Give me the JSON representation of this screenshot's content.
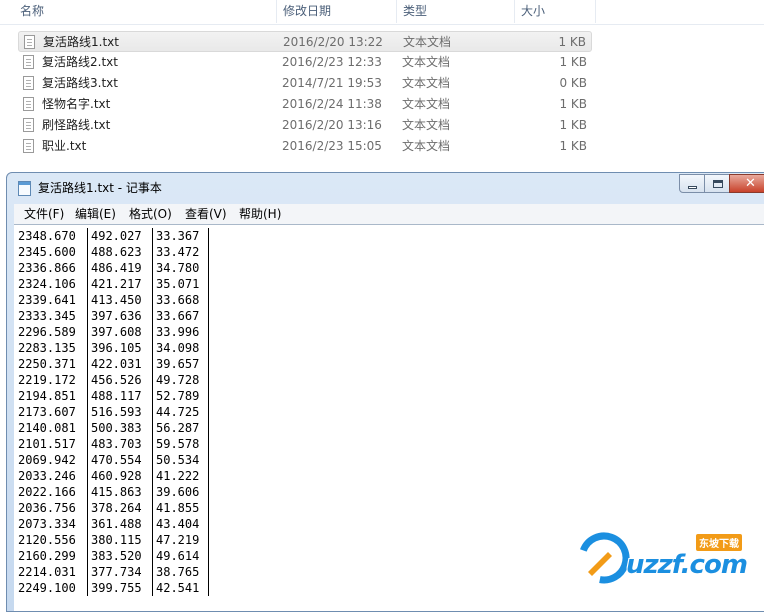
{
  "explorer": {
    "columns": {
      "name": "名称",
      "date": "修改日期",
      "type": "类型",
      "size": "大小"
    },
    "files": [
      {
        "name": "复活路线1.txt",
        "date": "2016/2/20 13:22",
        "type": "文本文档",
        "size": "1 KB"
      },
      {
        "name": "复活路线2.txt",
        "date": "2016/2/23 12:33",
        "type": "文本文档",
        "size": "1 KB"
      },
      {
        "name": "复活路线3.txt",
        "date": "2014/7/21 19:53",
        "type": "文本文档",
        "size": "0 KB"
      },
      {
        "name": "怪物名字.txt",
        "date": "2016/2/24 11:38",
        "type": "文本文档",
        "size": "1 KB"
      },
      {
        "name": "刷怪路线.txt",
        "date": "2016/2/20 13:16",
        "type": "文本文档",
        "size": "1 KB"
      },
      {
        "name": "职业.txt",
        "date": "2016/2/23 15:05",
        "type": "文本文档",
        "size": "1 KB"
      }
    ],
    "selected_index": 0
  },
  "notepad": {
    "title": "复活路线1.txt - 记事本",
    "icon": "notepad-icon",
    "menu": [
      "文件(F)",
      "编辑(E)",
      "格式(O)",
      "查看(V)",
      "帮助(H)"
    ],
    "close_glyph": "✕",
    "lines": [
      [
        "2348.670",
        "492.027",
        "33.367"
      ],
      [
        "2345.600",
        "488.623",
        "33.472"
      ],
      [
        "2336.866",
        "486.419",
        "34.780"
      ],
      [
        "2324.106",
        "421.217",
        "35.071"
      ],
      [
        "2339.641",
        "413.450",
        "33.668"
      ],
      [
        "2333.345",
        "397.636",
        "33.667"
      ],
      [
        "2296.589",
        "397.608",
        "33.996"
      ],
      [
        "2283.135",
        "396.105",
        "34.098"
      ],
      [
        "2250.371",
        "422.031",
        "39.657"
      ],
      [
        "2219.172",
        "456.526",
        "49.728"
      ],
      [
        "2194.851",
        "488.117",
        "52.789"
      ],
      [
        "2173.607",
        "516.593",
        "44.725"
      ],
      [
        "2140.081",
        "500.383",
        "56.287"
      ],
      [
        "2101.517",
        "483.703",
        "59.578"
      ],
      [
        "2069.942",
        "470.554",
        "50.534"
      ],
      [
        "2033.246",
        "460.928",
        "41.222"
      ],
      [
        "2022.166",
        "415.863",
        "39.606"
      ],
      [
        "2036.756",
        "378.264",
        "41.855"
      ],
      [
        "2073.334",
        "361.488",
        "43.404"
      ],
      [
        "2120.556",
        "380.115",
        "47.219"
      ],
      [
        "2160.299",
        "383.520",
        "49.614"
      ],
      [
        "2214.031",
        "377.734",
        "38.765"
      ],
      [
        "2249.100",
        "399.755",
        "42.541"
      ]
    ]
  },
  "watermark": {
    "text": "uzzf.com",
    "badge": "东坡下载"
  },
  "colors": {
    "accent": "#1b8fe0",
    "badge": "#f29b17",
    "close": "#c8422b"
  }
}
